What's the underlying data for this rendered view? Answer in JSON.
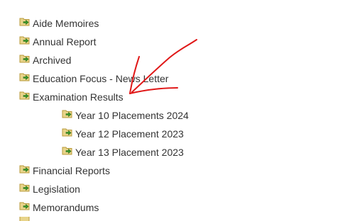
{
  "tree": {
    "items": [
      {
        "label": "Aide Memoires",
        "level": 0,
        "icon": "folder-arrow-icon"
      },
      {
        "label": "Annual Report",
        "level": 0,
        "icon": "folder-arrow-icon"
      },
      {
        "label": "Archived",
        "level": 0,
        "icon": "folder-arrow-icon"
      },
      {
        "label": "Education Focus - News Letter",
        "level": 0,
        "icon": "folder-arrow-icon"
      },
      {
        "label": "Examination Results",
        "level": 0,
        "icon": "folder-arrow-icon"
      },
      {
        "label": "Year 10 Placements 2024",
        "level": 1,
        "icon": "folder-arrow-icon"
      },
      {
        "label": "Year 12 Placement 2023",
        "level": 1,
        "icon": "folder-arrow-icon"
      },
      {
        "label": "Year 13 Placement 2023",
        "level": 1,
        "icon": "folder-arrow-icon"
      },
      {
        "label": "Financial Reports",
        "level": 0,
        "icon": "folder-arrow-icon"
      },
      {
        "label": "Legislation",
        "level": 0,
        "icon": "folder-arrow-icon"
      },
      {
        "label": "Memorandums",
        "level": 0,
        "icon": "folder-arrow-icon"
      }
    ]
  },
  "colors": {
    "text": "#333333",
    "folder": "#e8d48a",
    "folder_edge": "#b89a3a",
    "arrow_green": "#3c9a2a",
    "annotation": "#e01818"
  }
}
